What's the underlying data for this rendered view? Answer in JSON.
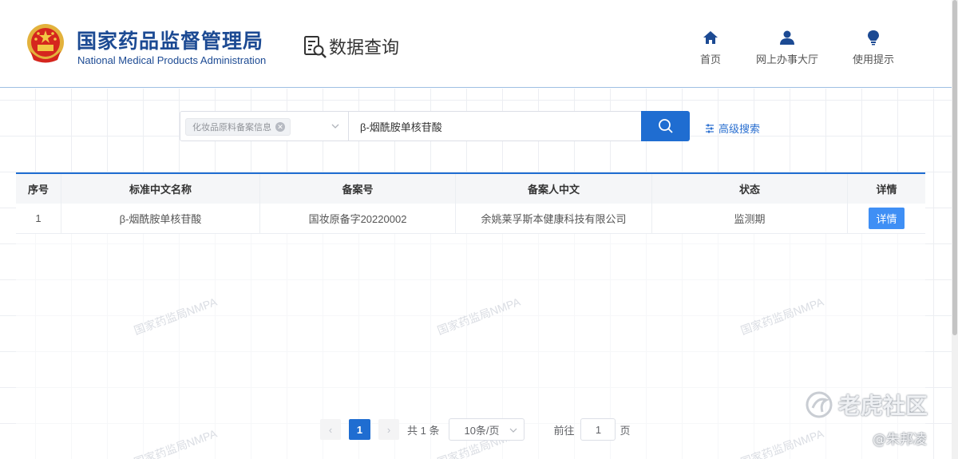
{
  "header": {
    "org_name_cn": "国家药品监督管理局",
    "org_name_en": "National Medical Products Administration",
    "query_title": "数据查询",
    "nav": [
      {
        "label": "首页",
        "icon": "home-icon"
      },
      {
        "label": "网上办事大厅",
        "icon": "user-icon"
      },
      {
        "label": "使用提示",
        "icon": "lightbulb-icon"
      }
    ]
  },
  "search": {
    "category_tag": "化妆品原料备案信息",
    "query": "β-烟酰胺单核苷酸",
    "advanced_label": "高级搜索"
  },
  "table": {
    "columns": [
      "序号",
      "标准中文名称",
      "备案号",
      "备案人中文",
      "状态",
      "详情"
    ],
    "rows": [
      {
        "index": "1",
        "name": "β-烟酰胺单核苷酸",
        "record_no": "国妆原备字20220002",
        "applicant": "余姚莱孚斯本健康科技有限公司",
        "status": "监测期",
        "action": "详情"
      }
    ]
  },
  "watermark": "国家药监局NMPA",
  "pagination": {
    "current_page": "1",
    "total_text": "共 1 条",
    "page_size": "10条/页",
    "goto_prefix": "前往",
    "goto_value": "1",
    "goto_suffix": "页"
  },
  "overlay": {
    "community_name": "老虎社区",
    "author": "@朱邦凌"
  },
  "colors": {
    "brand_blue": "#1c4a93",
    "accent": "#1f6dd1",
    "detail_button": "#3f8ff5"
  }
}
